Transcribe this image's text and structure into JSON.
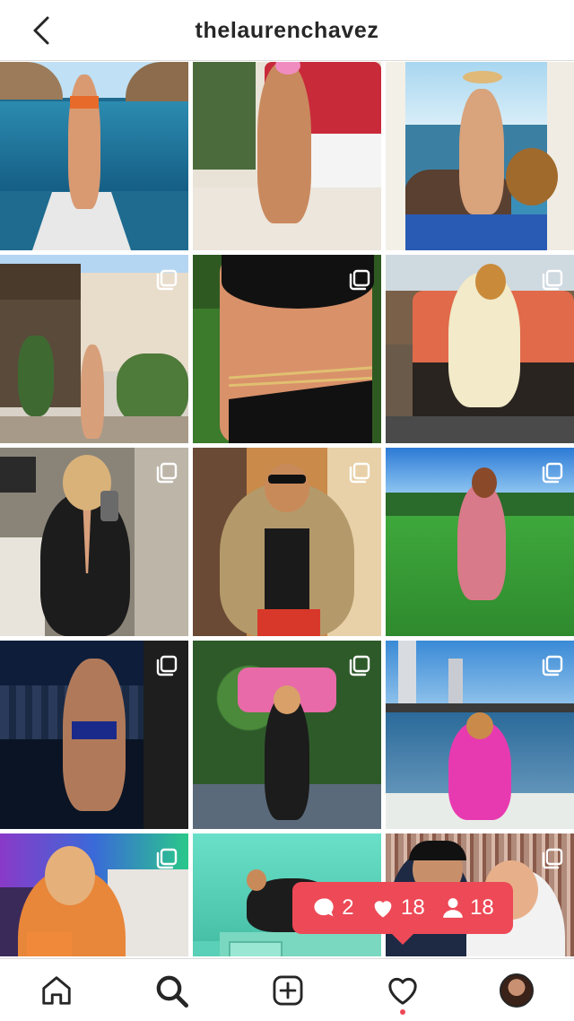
{
  "header": {
    "username": "thelaurenchavez",
    "back_icon": "chevron-left-icon"
  },
  "posts": [
    {
      "multi": false,
      "theme": "beach-boat"
    },
    {
      "multi": false,
      "theme": "bench"
    },
    {
      "multi": false,
      "theme": "ocean-rocks"
    },
    {
      "multi": true,
      "theme": "villa"
    },
    {
      "multi": true,
      "theme": "bikini-closeup"
    },
    {
      "multi": true,
      "theme": "terrace"
    },
    {
      "multi": true,
      "theme": "mirror-selfie"
    },
    {
      "multi": true,
      "theme": "street"
    },
    {
      "multi": true,
      "theme": "golf-lawn"
    },
    {
      "multi": true,
      "theme": "night-city"
    },
    {
      "multi": true,
      "theme": "flower-wall"
    },
    {
      "multi": true,
      "theme": "boat-waves"
    },
    {
      "multi": true,
      "theme": "cocktail"
    },
    {
      "multi": false,
      "theme": "teal-room"
    },
    {
      "multi": true,
      "theme": "tinsel"
    }
  ],
  "notification": {
    "comments": "2",
    "likes": "18",
    "follows": "18"
  },
  "nav": {
    "items": [
      "home-icon",
      "search-icon",
      "new-post-icon",
      "activity-heart-icon",
      "profile-avatar"
    ]
  },
  "colors": {
    "notification_bg": "#ed4956",
    "text": "#262626",
    "divider": "#dbdbdb"
  }
}
